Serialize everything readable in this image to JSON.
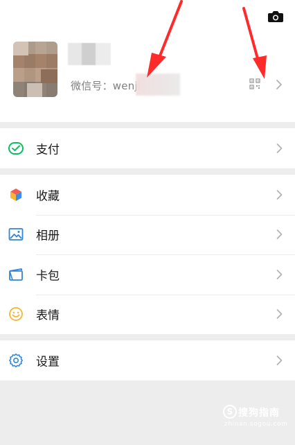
{
  "profile": {
    "wechat_id_label": "微信号：wenji",
    "icons": {
      "camera": "camera-icon",
      "qr": "qr-code-icon",
      "chevron": "chevron-right-icon"
    }
  },
  "menu": {
    "pay": {
      "label": "支付",
      "icon": "wechat-pay-icon",
      "color": "#07c160"
    },
    "items": [
      {
        "label": "收藏",
        "icon": "favorites-cube-icon"
      },
      {
        "label": "相册",
        "icon": "album-image-icon",
        "color": "#2f86d8"
      },
      {
        "label": "卡包",
        "icon": "card-wallet-icon",
        "color": "#2f86d8"
      },
      {
        "label": "表情",
        "icon": "sticker-smile-icon",
        "color": "#f4b633"
      }
    ],
    "settings": {
      "label": "设置",
      "icon": "settings-gear-icon",
      "color": "#2f86d8"
    }
  },
  "annotations": {
    "arrow_color": "#ff2a2a",
    "arrow_count": 2
  },
  "watermark": {
    "logo": "S",
    "text": "搜狗指南",
    "url": "zhinan.sogou.com"
  }
}
